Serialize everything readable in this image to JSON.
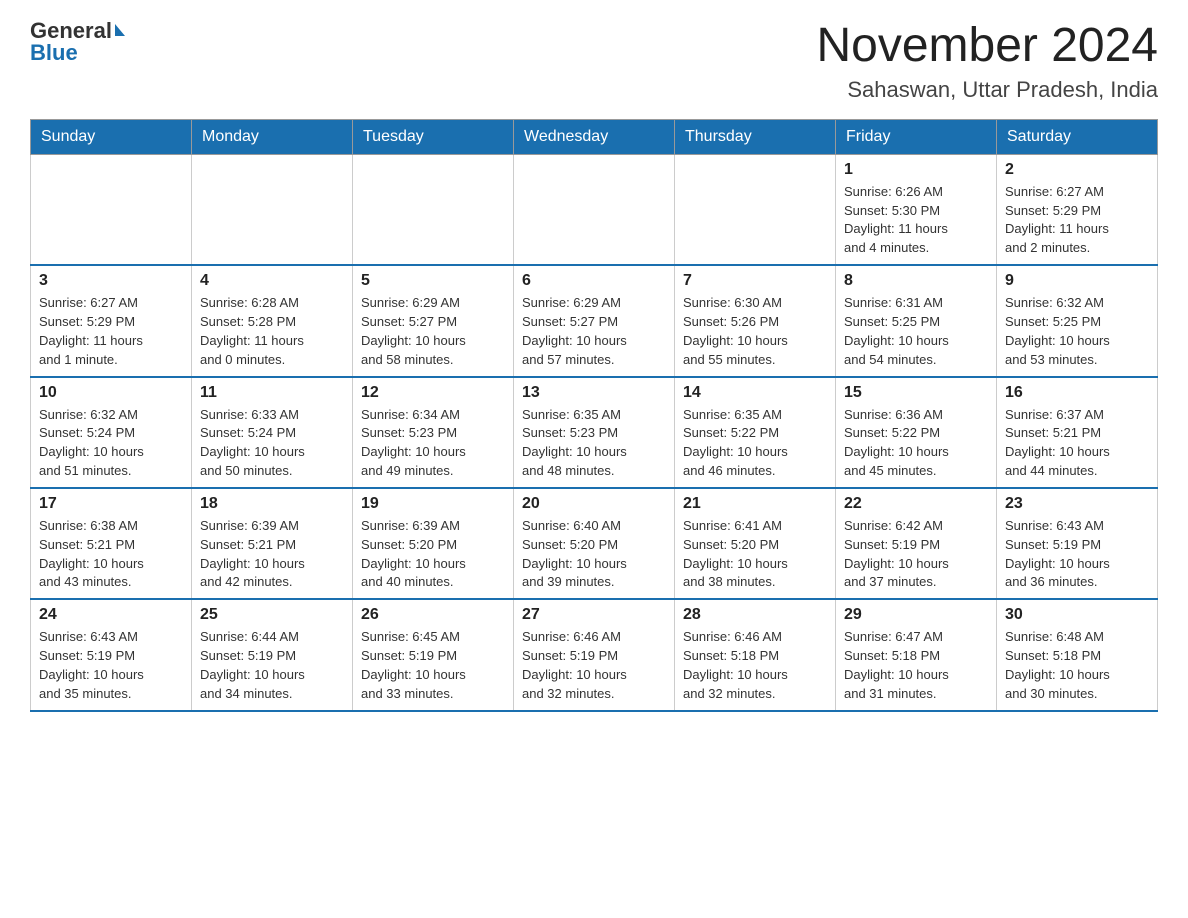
{
  "header": {
    "logo_general": "General",
    "logo_blue": "Blue",
    "month_title": "November 2024",
    "location": "Sahaswan, Uttar Pradesh, India"
  },
  "weekdays": [
    "Sunday",
    "Monday",
    "Tuesday",
    "Wednesday",
    "Thursday",
    "Friday",
    "Saturday"
  ],
  "weeks": [
    {
      "days": [
        {
          "number": "",
          "info": ""
        },
        {
          "number": "",
          "info": ""
        },
        {
          "number": "",
          "info": ""
        },
        {
          "number": "",
          "info": ""
        },
        {
          "number": "",
          "info": ""
        },
        {
          "number": "1",
          "info": "Sunrise: 6:26 AM\nSunset: 5:30 PM\nDaylight: 11 hours\nand 4 minutes."
        },
        {
          "number": "2",
          "info": "Sunrise: 6:27 AM\nSunset: 5:29 PM\nDaylight: 11 hours\nand 2 minutes."
        }
      ]
    },
    {
      "days": [
        {
          "number": "3",
          "info": "Sunrise: 6:27 AM\nSunset: 5:29 PM\nDaylight: 11 hours\nand 1 minute."
        },
        {
          "number": "4",
          "info": "Sunrise: 6:28 AM\nSunset: 5:28 PM\nDaylight: 11 hours\nand 0 minutes."
        },
        {
          "number": "5",
          "info": "Sunrise: 6:29 AM\nSunset: 5:27 PM\nDaylight: 10 hours\nand 58 minutes."
        },
        {
          "number": "6",
          "info": "Sunrise: 6:29 AM\nSunset: 5:27 PM\nDaylight: 10 hours\nand 57 minutes."
        },
        {
          "number": "7",
          "info": "Sunrise: 6:30 AM\nSunset: 5:26 PM\nDaylight: 10 hours\nand 55 minutes."
        },
        {
          "number": "8",
          "info": "Sunrise: 6:31 AM\nSunset: 5:25 PM\nDaylight: 10 hours\nand 54 minutes."
        },
        {
          "number": "9",
          "info": "Sunrise: 6:32 AM\nSunset: 5:25 PM\nDaylight: 10 hours\nand 53 minutes."
        }
      ]
    },
    {
      "days": [
        {
          "number": "10",
          "info": "Sunrise: 6:32 AM\nSunset: 5:24 PM\nDaylight: 10 hours\nand 51 minutes."
        },
        {
          "number": "11",
          "info": "Sunrise: 6:33 AM\nSunset: 5:24 PM\nDaylight: 10 hours\nand 50 minutes."
        },
        {
          "number": "12",
          "info": "Sunrise: 6:34 AM\nSunset: 5:23 PM\nDaylight: 10 hours\nand 49 minutes."
        },
        {
          "number": "13",
          "info": "Sunrise: 6:35 AM\nSunset: 5:23 PM\nDaylight: 10 hours\nand 48 minutes."
        },
        {
          "number": "14",
          "info": "Sunrise: 6:35 AM\nSunset: 5:22 PM\nDaylight: 10 hours\nand 46 minutes."
        },
        {
          "number": "15",
          "info": "Sunrise: 6:36 AM\nSunset: 5:22 PM\nDaylight: 10 hours\nand 45 minutes."
        },
        {
          "number": "16",
          "info": "Sunrise: 6:37 AM\nSunset: 5:21 PM\nDaylight: 10 hours\nand 44 minutes."
        }
      ]
    },
    {
      "days": [
        {
          "number": "17",
          "info": "Sunrise: 6:38 AM\nSunset: 5:21 PM\nDaylight: 10 hours\nand 43 minutes."
        },
        {
          "number": "18",
          "info": "Sunrise: 6:39 AM\nSunset: 5:21 PM\nDaylight: 10 hours\nand 42 minutes."
        },
        {
          "number": "19",
          "info": "Sunrise: 6:39 AM\nSunset: 5:20 PM\nDaylight: 10 hours\nand 40 minutes."
        },
        {
          "number": "20",
          "info": "Sunrise: 6:40 AM\nSunset: 5:20 PM\nDaylight: 10 hours\nand 39 minutes."
        },
        {
          "number": "21",
          "info": "Sunrise: 6:41 AM\nSunset: 5:20 PM\nDaylight: 10 hours\nand 38 minutes."
        },
        {
          "number": "22",
          "info": "Sunrise: 6:42 AM\nSunset: 5:19 PM\nDaylight: 10 hours\nand 37 minutes."
        },
        {
          "number": "23",
          "info": "Sunrise: 6:43 AM\nSunset: 5:19 PM\nDaylight: 10 hours\nand 36 minutes."
        }
      ]
    },
    {
      "days": [
        {
          "number": "24",
          "info": "Sunrise: 6:43 AM\nSunset: 5:19 PM\nDaylight: 10 hours\nand 35 minutes."
        },
        {
          "number": "25",
          "info": "Sunrise: 6:44 AM\nSunset: 5:19 PM\nDaylight: 10 hours\nand 34 minutes."
        },
        {
          "number": "26",
          "info": "Sunrise: 6:45 AM\nSunset: 5:19 PM\nDaylight: 10 hours\nand 33 minutes."
        },
        {
          "number": "27",
          "info": "Sunrise: 6:46 AM\nSunset: 5:19 PM\nDaylight: 10 hours\nand 32 minutes."
        },
        {
          "number": "28",
          "info": "Sunrise: 6:46 AM\nSunset: 5:18 PM\nDaylight: 10 hours\nand 32 minutes."
        },
        {
          "number": "29",
          "info": "Sunrise: 6:47 AM\nSunset: 5:18 PM\nDaylight: 10 hours\nand 31 minutes."
        },
        {
          "number": "30",
          "info": "Sunrise: 6:48 AM\nSunset: 5:18 PM\nDaylight: 10 hours\nand 30 minutes."
        }
      ]
    }
  ]
}
